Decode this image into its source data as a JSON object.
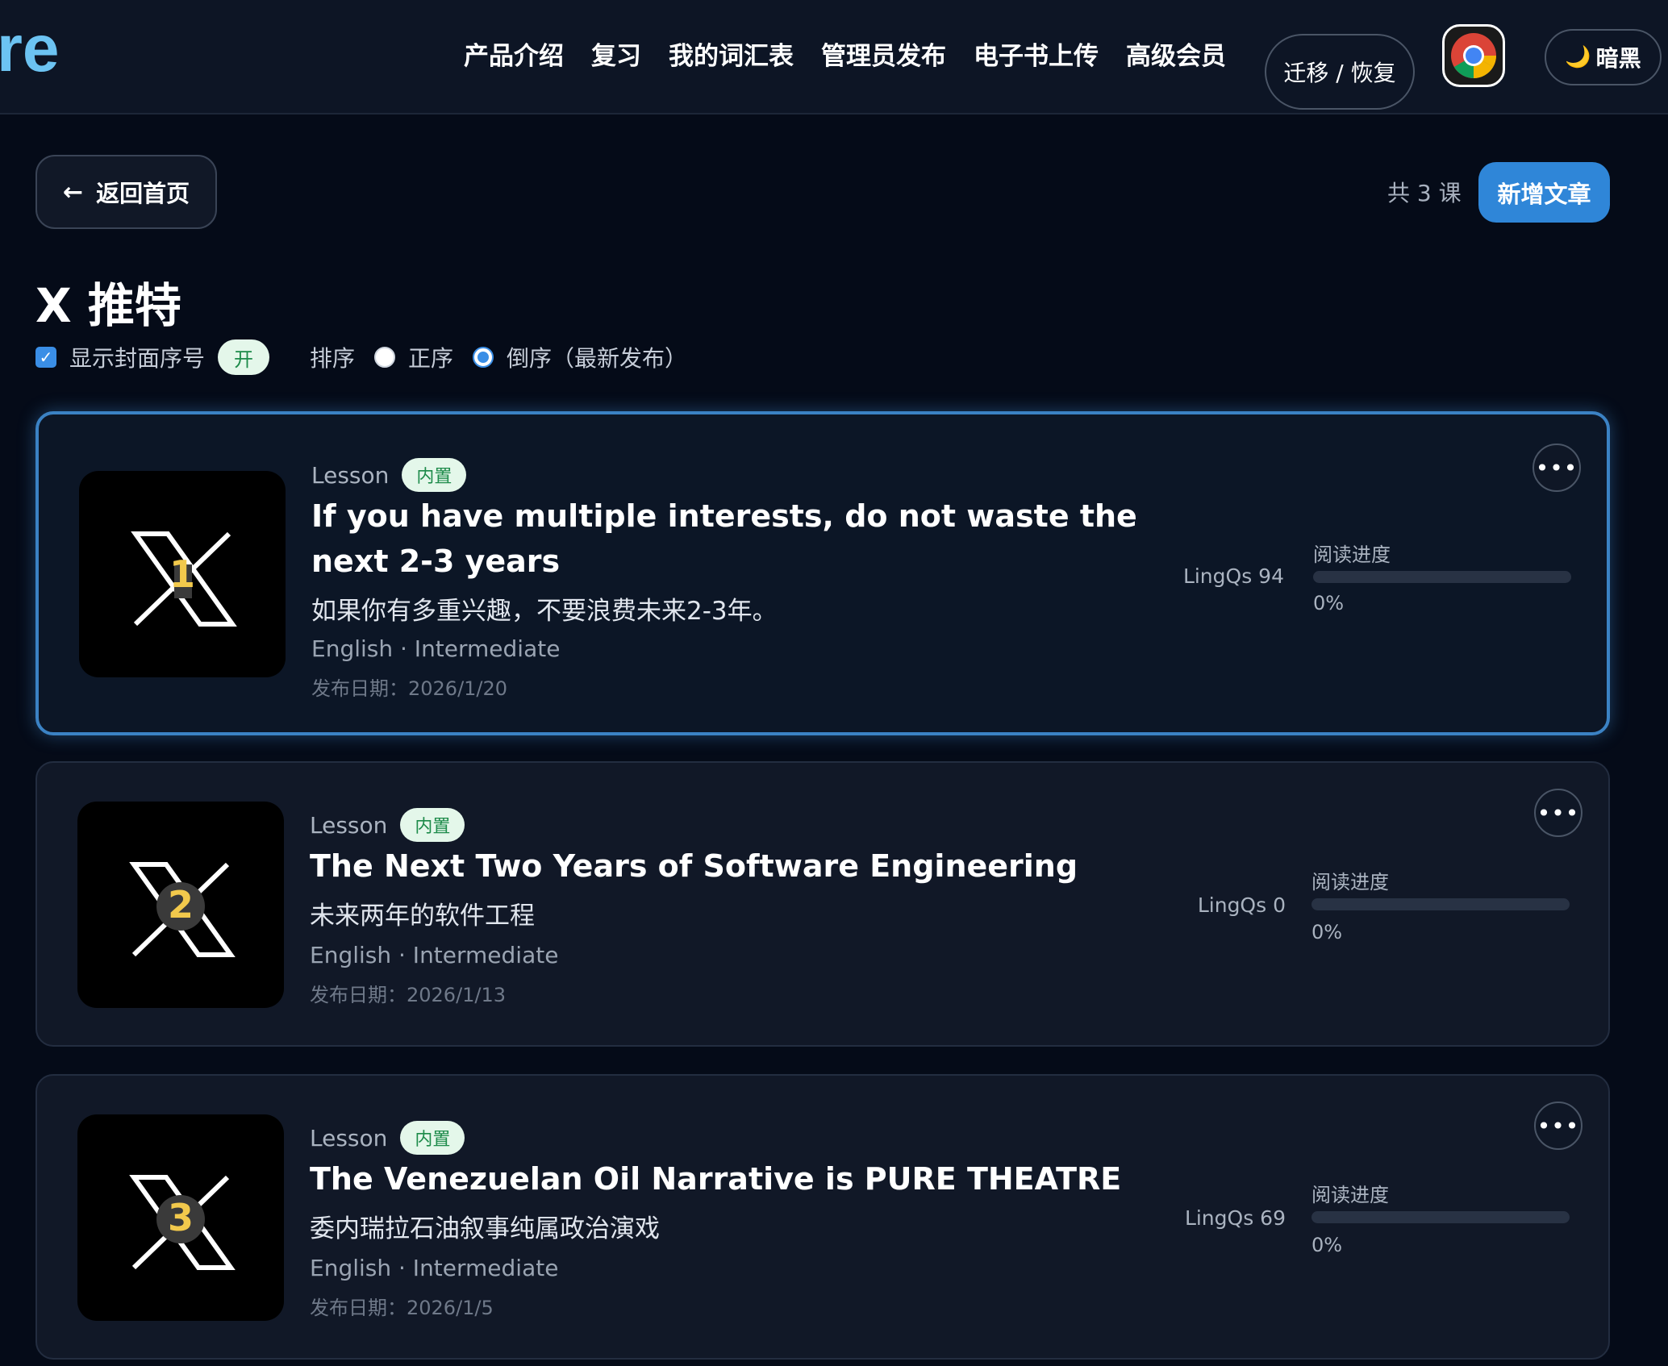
{
  "header": {
    "logo_fragment": "re",
    "nav": [
      "产品介绍",
      "复习",
      "我的词汇表",
      "管理员发布",
      "电子书上传",
      "高级会员"
    ],
    "migrate_label": "迁移 / 恢复",
    "theme_icon": "🌙",
    "theme_label": "暗黑"
  },
  "toolbar": {
    "back_label": "返回首页",
    "total_label": "共 3 课",
    "new_article_label": "新增文章"
  },
  "page": {
    "title": "X 推特",
    "show_cover_index_label": "显示封面序号",
    "show_cover_index_checked": true,
    "show_cover_index_badge": "开",
    "sort_label": "排序",
    "sort_options": [
      "正序",
      "倒序（最新发布）"
    ],
    "sort_selected": "倒序（最新发布）"
  },
  "lessons": [
    {
      "index": "1",
      "kind": "Lesson",
      "badge": "内置",
      "title": "If you have multiple interests, do not waste the next 2-3 years",
      "subtitle": "如果你有多重兴趣，不要浪费未来2-3年。",
      "meta": "English · Intermediate",
      "date": "发布日期：2026/1/20",
      "lingqs": "LingQs 94",
      "progress_label": "阅读进度",
      "progress": 0,
      "progress_text": "0%",
      "active": true
    },
    {
      "index": "2",
      "kind": "Lesson",
      "badge": "内置",
      "title": "The Next Two Years of Software Engineering",
      "subtitle": "未来两年的软件工程",
      "meta": "English · Intermediate",
      "date": "发布日期：2026/1/13",
      "lingqs": "LingQs 0",
      "progress_label": "阅读进度",
      "progress": 0,
      "progress_text": "0%",
      "active": false
    },
    {
      "index": "3",
      "kind": "Lesson",
      "badge": "内置",
      "title": "The Venezuelan Oil Narrative is PURE THEATRE",
      "subtitle": "委内瑞拉石油叙事纯属政治演戏",
      "meta": "English · Intermediate",
      "date": "发布日期：2026/1/5",
      "lingqs": "LingQs 69",
      "progress_label": "阅读进度",
      "progress": 0,
      "progress_text": "0%",
      "active": false
    }
  ],
  "colors": {
    "accent": "#2f86d8",
    "active_border": "#3b82c4",
    "badge_bg": "#e4f7ea",
    "badge_text": "#1d8b4a",
    "cover_number": "#f2c94c"
  },
  "icons": {
    "back": "arrow-left-icon",
    "more": "more-horizontal-icon",
    "browser": "chrome-icon",
    "theme": "moon-icon",
    "cover": "x-logo-icon"
  }
}
